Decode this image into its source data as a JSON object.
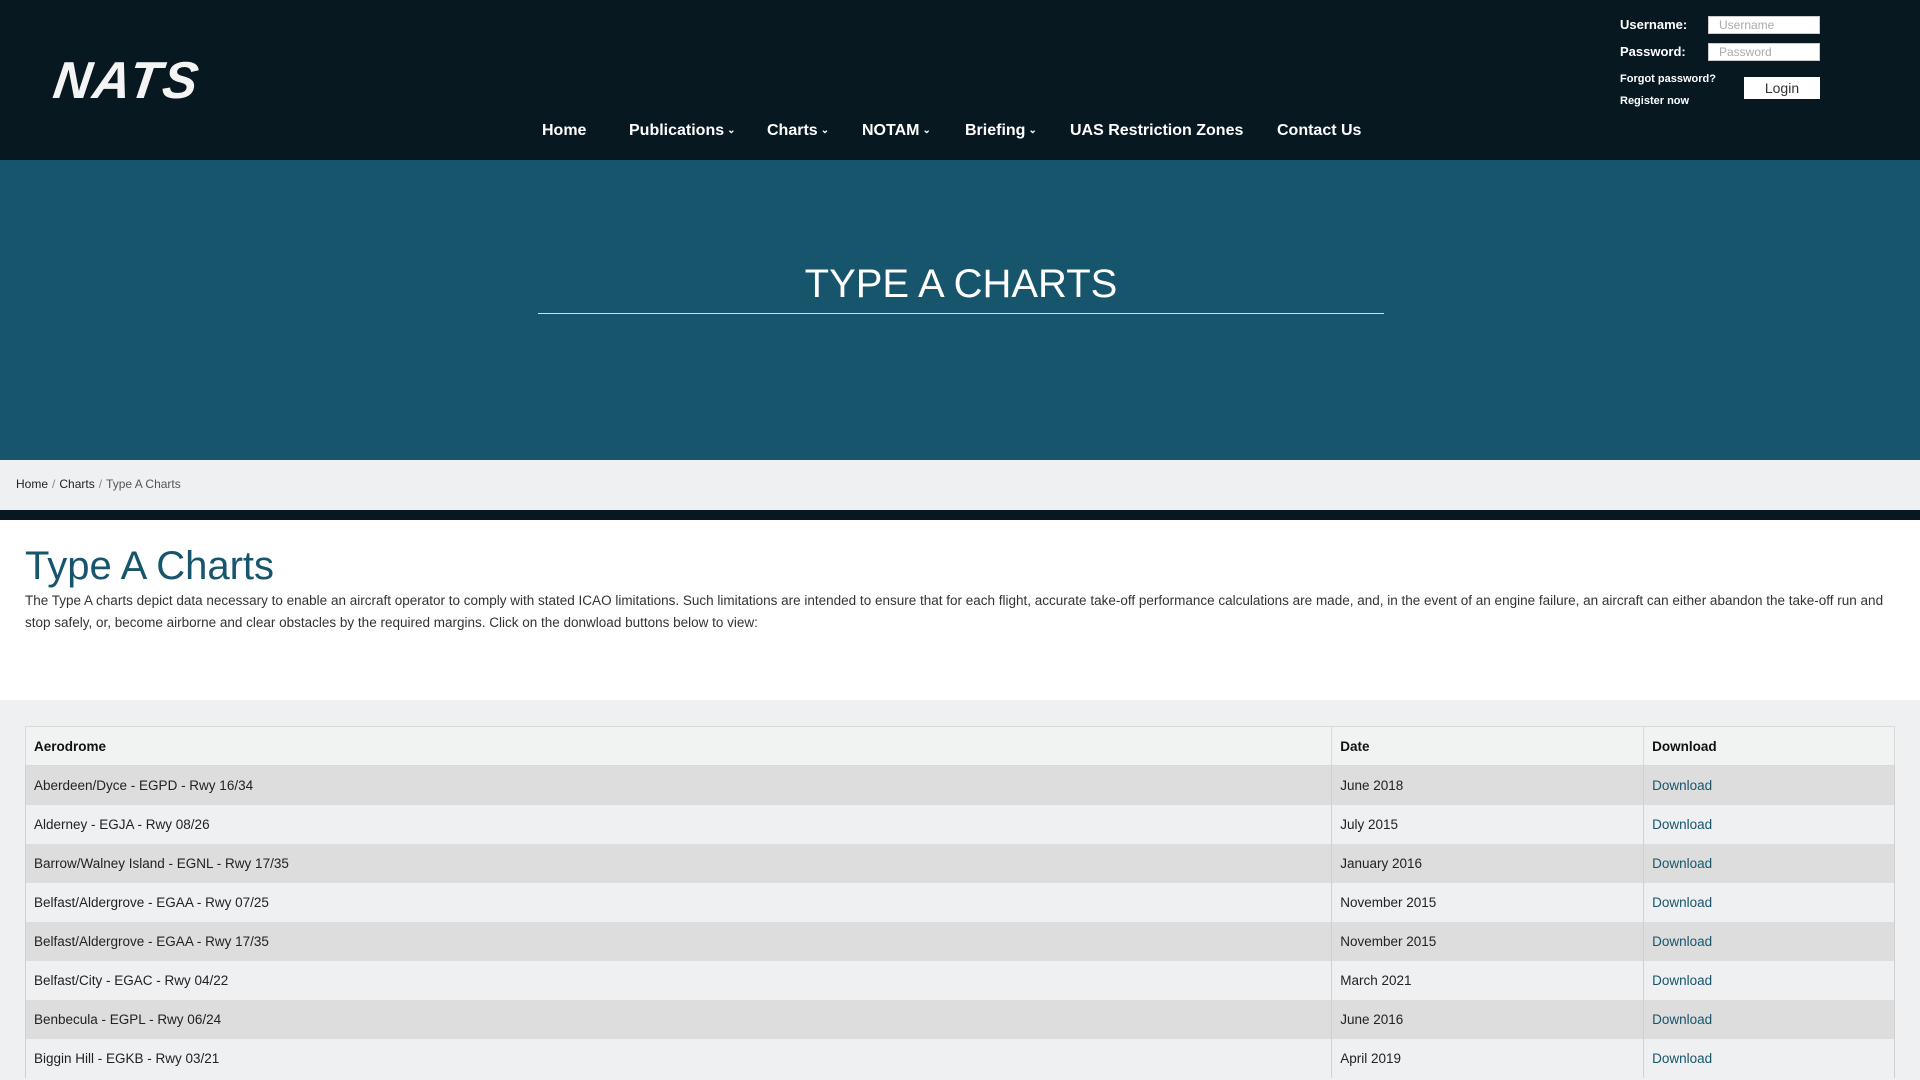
{
  "header": {
    "logo_text": "NATS",
    "nav": [
      {
        "label": "Home",
        "dropdown": false
      },
      {
        "label": "Publications",
        "dropdown": true
      },
      {
        "label": "Charts",
        "dropdown": true
      },
      {
        "label": "NOTAM",
        "dropdown": true
      },
      {
        "label": "Briefing",
        "dropdown": true
      },
      {
        "label": "UAS Restriction Zones",
        "dropdown": false
      },
      {
        "label": "Contact Us",
        "dropdown": false
      }
    ],
    "login": {
      "username_label": "Username:",
      "username_placeholder": "Username",
      "password_label": "Password:",
      "password_placeholder": "Password",
      "forgot_password": "Forgot password?",
      "register": "Register now",
      "login_button": "Login"
    }
  },
  "hero": {
    "title": "TYPE A CHARTS"
  },
  "breadcrumb": {
    "items": [
      "Home",
      "Charts",
      "Type A Charts"
    ],
    "separator": "/"
  },
  "intro": {
    "title": "Type A Charts",
    "description": "The Type A charts depict data necessary to enable an aircraft operator to comply with stated ICAO limitations. Such limitations are intended to ensure that for each flight, accurate take-off performance calculations are made, and, in the event of an engine failure, an aircraft can either abandon the take-off run and stop safely, or, become airborne and clear obstacles by the required margins. Click on the donwload buttons below to view:"
  },
  "table": {
    "headers": [
      "Aerodrome",
      "Date",
      "Download"
    ],
    "rows": [
      {
        "aerodrome": "Aberdeen/Dyce - EGPD - Rwy 16/34",
        "date": "June 2018",
        "download": "Download"
      },
      {
        "aerodrome": "Alderney - EGJA - Rwy 08/26",
        "date": "July 2015",
        "download": "Download"
      },
      {
        "aerodrome": "Barrow/Walney Island - EGNL - Rwy 17/35",
        "date": "January 2016",
        "download": "Download"
      },
      {
        "aerodrome": "Belfast/Aldergrove - EGAA - Rwy 07/25",
        "date": "November 2015",
        "download": "Download"
      },
      {
        "aerodrome": "Belfast/Aldergrove - EGAA - Rwy 17/35",
        "date": "November 2015",
        "download": "Download"
      },
      {
        "aerodrome": "Belfast/City - EGAC - Rwy 04/22",
        "date": "March 2021",
        "download": "Download"
      },
      {
        "aerodrome": "Benbecula - EGPL - Rwy 06/24",
        "date": "June 2016",
        "download": "Download"
      },
      {
        "aerodrome": "Biggin Hill - EGKB - Rwy 03/21",
        "date": "April 2019",
        "download": "Download"
      }
    ]
  },
  "colors": {
    "header_bg": "#071820",
    "hero_bg": "#16556b",
    "accent": "#16556b",
    "page_bg": "#eff0f1"
  }
}
